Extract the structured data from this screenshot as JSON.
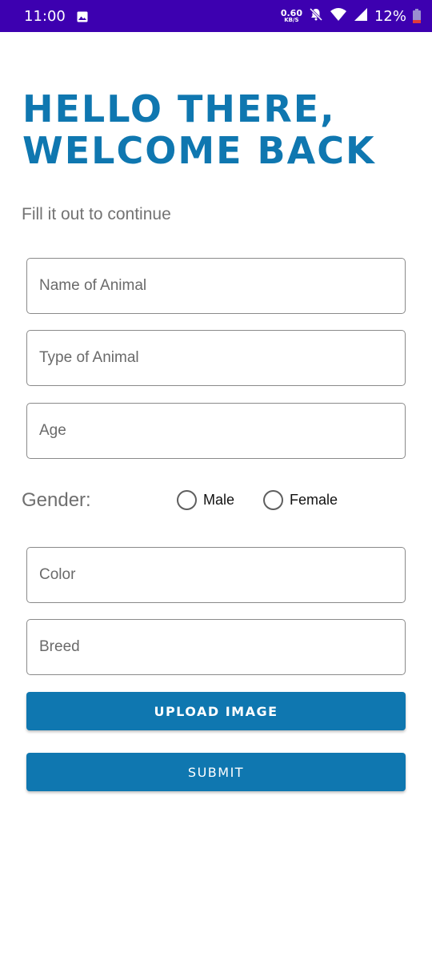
{
  "status_bar": {
    "time": "11:00",
    "net_speed_value": "0.60",
    "net_speed_unit": "KB/S",
    "battery_percent": "12%",
    "icons": [
      "image-icon",
      "mute-bell-icon",
      "wifi-icon",
      "signal-icon",
      "battery-icon"
    ]
  },
  "header": {
    "title_line1": "Hello there,",
    "title_line2": "Welcome Back",
    "subtitle": "Fill it out to continue"
  },
  "form": {
    "name_placeholder": "Name of Animal",
    "type_placeholder": "Type of Animal",
    "age_placeholder": "Age",
    "gender_label": "Gender:",
    "gender_options": [
      "Male",
      "Female"
    ],
    "color_placeholder": "Color",
    "breed_placeholder": "Breed",
    "upload_label": "UPLOAD IMAGE",
    "submit_label": "SUBMIT"
  },
  "colors": {
    "status_bar": "#3d00b0",
    "accent": "#0f77b0"
  }
}
